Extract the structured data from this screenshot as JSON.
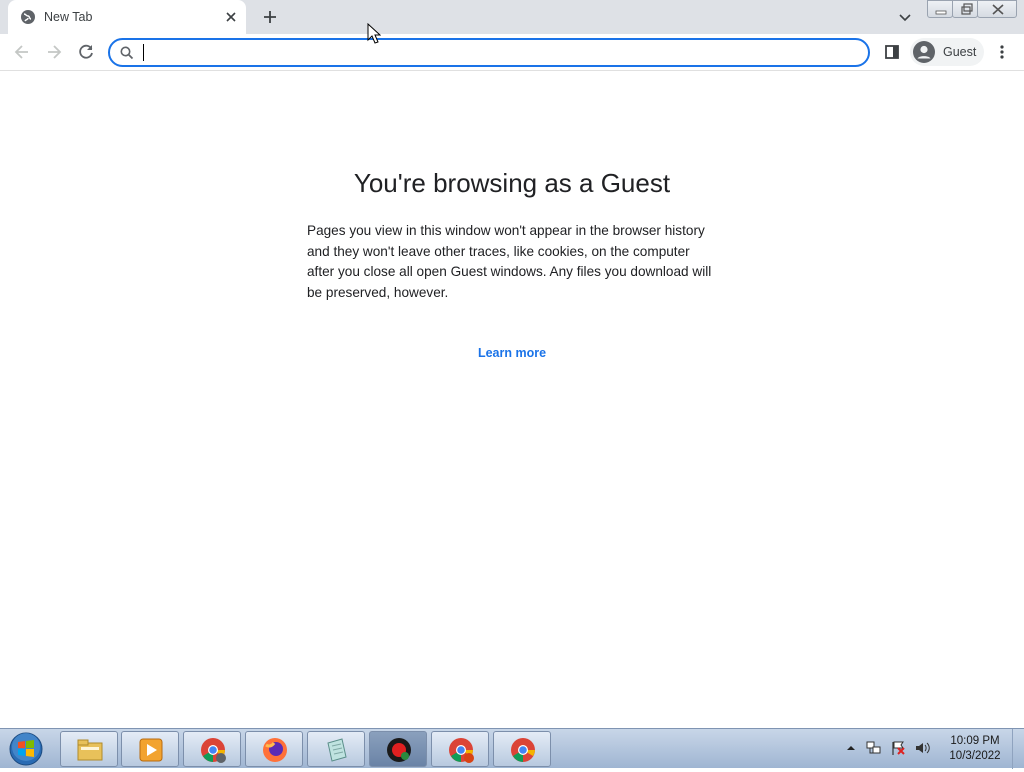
{
  "browser": {
    "tab": {
      "title": "New Tab",
      "favicon": "globe-icon",
      "close_icon": "close-icon"
    },
    "new_tab_icon": "plus-icon",
    "tab_search_icon": "chevron-down-icon",
    "window_controls": [
      "minimize-icon",
      "restore-icon",
      "close-icon"
    ]
  },
  "toolbar": {
    "back_icon": "arrow-left-icon",
    "forward_icon": "arrow-right-icon",
    "reload_icon": "reload-icon",
    "omnibox": {
      "value": "",
      "placeholder": "",
      "icon": "search-icon"
    },
    "side_panel_icon": "side-panel-icon",
    "profile_label": "Guest",
    "profile_icon": "avatar-icon",
    "menu_icon": "more-vert-icon"
  },
  "page": {
    "heading": "You're browsing as a Guest",
    "description": "Pages you view in this window won't appear in the browser history and they won't leave other traces, like cookies, on the computer after you close all open Guest windows. Any files you download will be preserved, however.",
    "learn_more": "Learn more",
    "accent_color": "#1a73e8"
  },
  "taskbar": {
    "start_icon": "windows-start-icon",
    "apps": [
      {
        "name": "file-explorer-icon"
      },
      {
        "name": "media-player-icon"
      },
      {
        "name": "chrome-user-icon"
      },
      {
        "name": "firefox-icon"
      },
      {
        "name": "notepad-icon"
      },
      {
        "name": "recorder-icon"
      },
      {
        "name": "chrome-s-icon"
      },
      {
        "name": "chrome-icon"
      }
    ],
    "tray_icons": [
      "show-hidden-icon",
      "network-icon",
      "flag-icon",
      "volume-icon"
    ],
    "time": "10:09 PM",
    "date": "10/3/2022"
  }
}
